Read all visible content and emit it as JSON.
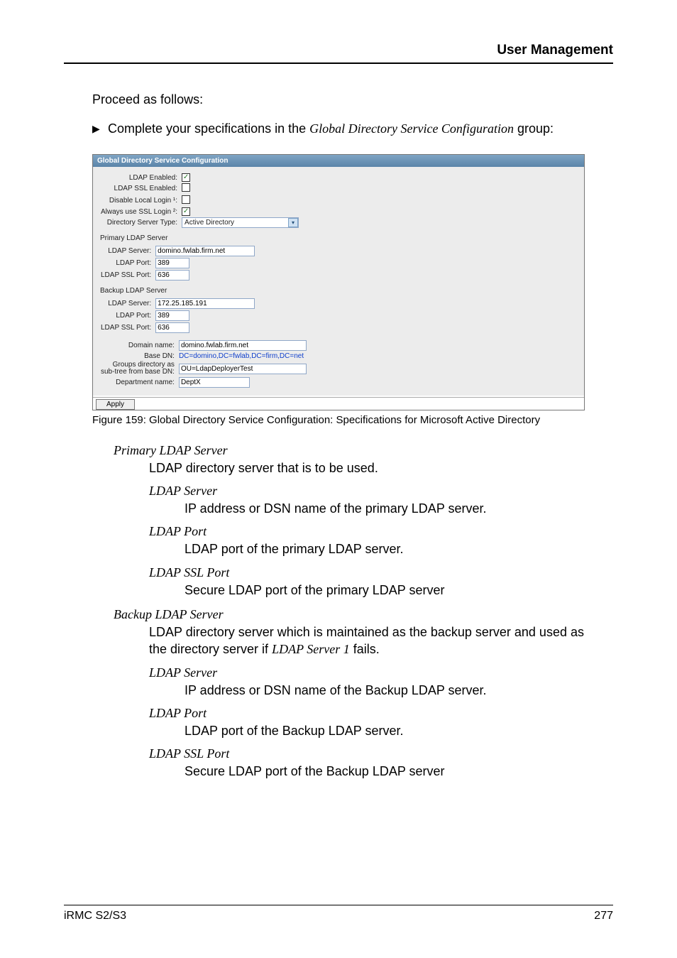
{
  "header": {
    "title": "User Management"
  },
  "intro": "Proceed as follows:",
  "bullet": {
    "prefix": "Complete your specifications in the ",
    "ref": "Global Directory Service Configuration",
    "suffix": " group:"
  },
  "panel": {
    "title": "Global Directory Service Configuration",
    "ldap_enabled_label": "LDAP Enabled:",
    "ldap_enabled_checked": "✓",
    "ldap_ssl_enabled_label": "LDAP SSL Enabled:",
    "disable_local_login_label": "Disable Local Login ¹:",
    "always_use_ssl_login_label": "Always use SSL Login ²:",
    "always_use_ssl_login_checked": "✓",
    "dir_server_type_label": "Directory Server Type:",
    "dir_server_type_value": "Active Directory",
    "primary_header": "Primary LDAP Server",
    "primary_server_label": "LDAP Server:",
    "primary_server_value": "domino.fwlab.firm.net",
    "primary_port_label": "LDAP Port:",
    "primary_port_value": "389",
    "primary_ssl_port_label": "LDAP SSL Port:",
    "primary_ssl_port_value": "636",
    "backup_header": "Backup LDAP Server",
    "backup_server_label": "LDAP Server:",
    "backup_server_value": "172.25.185.191",
    "backup_port_label": "LDAP Port:",
    "backup_port_value": "389",
    "backup_ssl_port_label": "LDAP SSL Port:",
    "backup_ssl_port_value": "636",
    "domain_name_label": "Domain name:",
    "domain_name_value": "domino.fwlab.firm.net",
    "base_dn_label": "Base DN:",
    "base_dn_value": "DC=domino,DC=fwlab,DC=firm,DC=net",
    "groups_dir_label_a": "Groups directory as",
    "groups_dir_label_b": "sub-tree from base DN:",
    "groups_dir_value": "OU=LdapDeployerTest",
    "dept_name_label": "Department name:",
    "dept_name_value": "DeptX",
    "apply": "Apply"
  },
  "caption": "Figure 159: Global Directory Service Configuration: Specifications for Microsoft Active Directory",
  "defs": {
    "primary": {
      "term": "Primary LDAP Server",
      "desc": "LDAP directory server that is to be used.",
      "ldap_server_term": "LDAP Server",
      "ldap_server_desc": "IP address or DSN name of the primary LDAP server.",
      "ldap_port_term": "LDAP Port",
      "ldap_port_desc": "LDAP port of the primary LDAP server.",
      "ldap_ssl_port_term": "LDAP SSL Port",
      "ldap_ssl_port_desc": "Secure LDAP port of the primary LDAP server"
    },
    "backup": {
      "term": "Backup LDAP Server",
      "desc_pre": "LDAP directory server which is maintained as the backup server and used as the directory server if ",
      "desc_ref": "LDAP Server 1",
      "desc_post": " fails.",
      "ldap_server_term": "LDAP Server",
      "ldap_server_desc": "IP address or DSN name of the Backup LDAP server.",
      "ldap_port_term": "LDAP Port",
      "ldap_port_desc": "LDAP port of the Backup LDAP server.",
      "ldap_ssl_port_term": "LDAP SSL Port",
      "ldap_ssl_port_desc": "Secure LDAP port of the Backup LDAP server"
    }
  },
  "footer": {
    "left": "iRMC S2/S3",
    "right": "277"
  }
}
